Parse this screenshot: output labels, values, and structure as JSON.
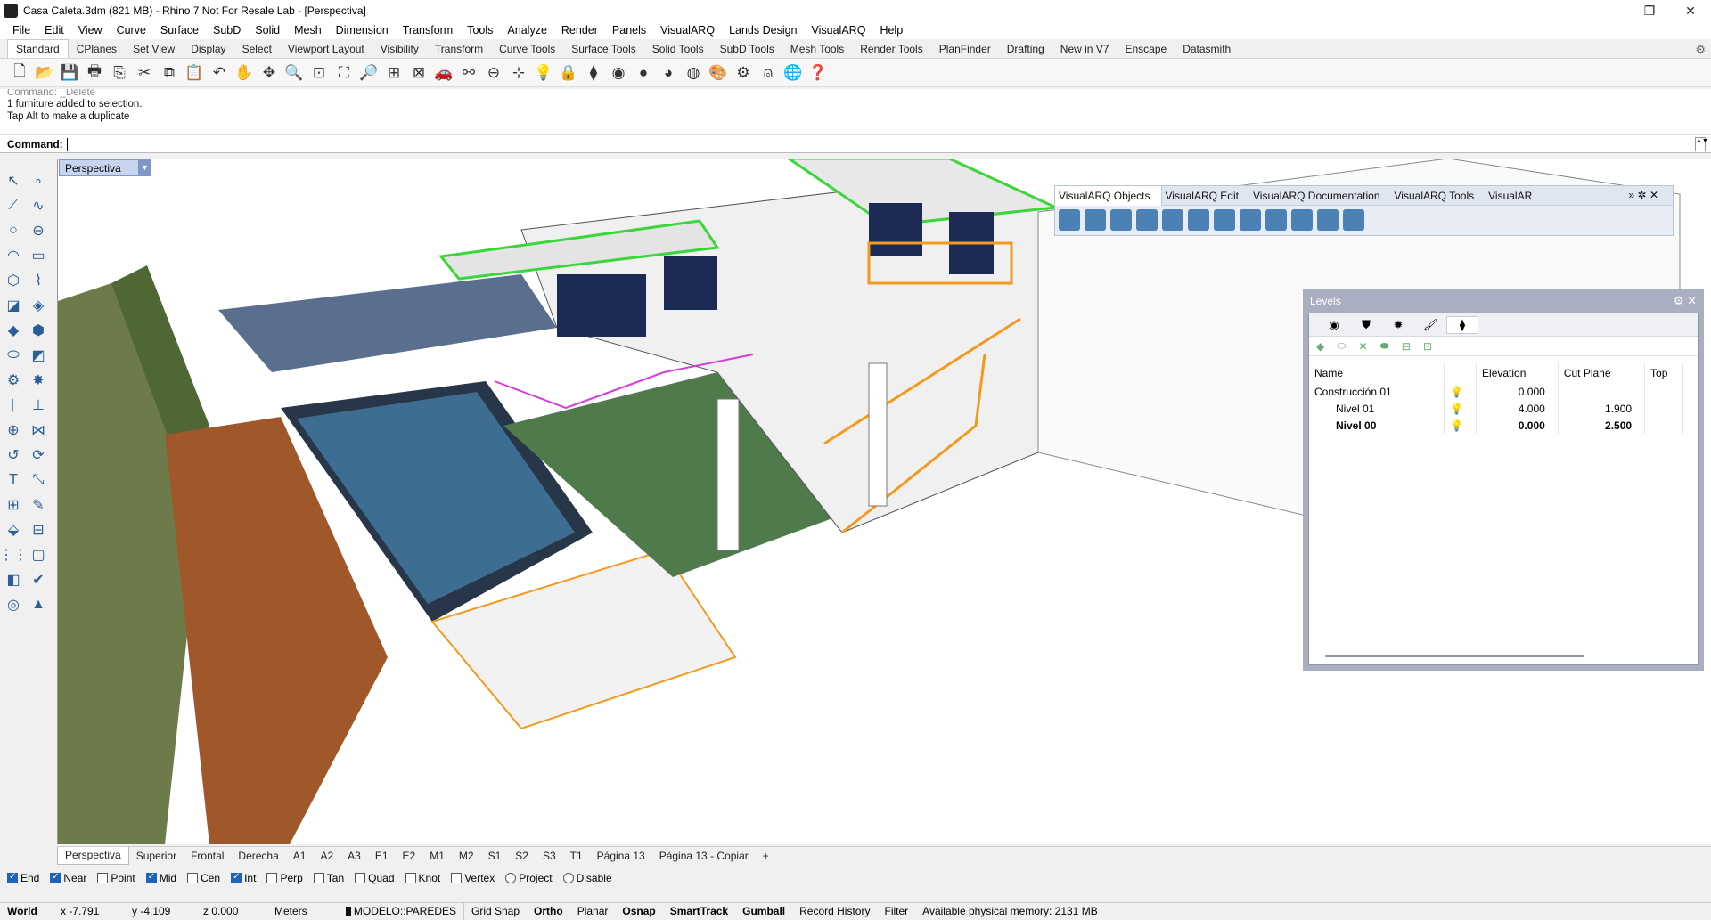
{
  "window": {
    "title": "Casa Caleta.3dm (821 MB) - Rhino 7 Not For Resale Lab - [Perspectiva]",
    "controls": [
      "—",
      "❐",
      "✕"
    ]
  },
  "menu": [
    "File",
    "Edit",
    "View",
    "Curve",
    "Surface",
    "SubD",
    "Solid",
    "Mesh",
    "Dimension",
    "Transform",
    "Tools",
    "Analyze",
    "Render",
    "Panels",
    "VisualARQ",
    "Lands Design",
    "VisualARQ",
    "Help"
  ],
  "toolbar_tabs": [
    "Standard",
    "CPlanes",
    "Set View",
    "Display",
    "Select",
    "Viewport Layout",
    "Visibility",
    "Transform",
    "Curve Tools",
    "Surface Tools",
    "Solid Tools",
    "SubD Tools",
    "Mesh Tools",
    "Render Tools",
    "PlanFinder",
    "Drafting",
    "New in V7",
    "Enscape",
    "Datasmith"
  ],
  "command_history": {
    "cut_line": "Command: _Delete",
    "lines": [
      "1 furniture added to selection.",
      "Tap Alt to make a duplicate"
    ]
  },
  "command": {
    "label": "Command:",
    "value": ""
  },
  "viewport": {
    "name": "Perspectiva"
  },
  "visualarq_toolbar": {
    "tabs": [
      "VisualARQ Objects",
      "VisualARQ Edit",
      "VisualARQ Documentation",
      "VisualARQ Tools",
      "VisualAR"
    ],
    "controls": "» ✲ ✕"
  },
  "levels": {
    "title": "Levels",
    "columns": [
      "Name",
      "",
      "Elevation",
      "Cut Plane",
      "Top"
    ],
    "rows": [
      {
        "name": "Construcción 01",
        "elevation": "0.000",
        "cut": ""
      },
      {
        "name": "Nivel 01",
        "elevation": "4.000",
        "cut": "1.900"
      },
      {
        "name": "Nivel 00",
        "elevation": "0.000",
        "cut": "2.500"
      }
    ]
  },
  "view_tabs": [
    "Perspectiva",
    "Superior",
    "Frontal",
    "Derecha",
    "A1",
    "A2",
    "A3",
    "E1",
    "E2",
    "M1",
    "M2",
    "S1",
    "S2",
    "S3",
    "T1",
    "Página 13",
    "Página 13 - Copiar",
    "+"
  ],
  "osnaps": [
    {
      "label": "End",
      "on": true
    },
    {
      "label": "Near",
      "on": true
    },
    {
      "label": "Point",
      "on": false
    },
    {
      "label": "Mid",
      "on": true
    },
    {
      "label": "Cen",
      "on": false
    },
    {
      "label": "Int",
      "on": true
    },
    {
      "label": "Perp",
      "on": false
    },
    {
      "label": "Tan",
      "on": false
    },
    {
      "label": "Quad",
      "on": false
    },
    {
      "label": "Knot",
      "on": false
    },
    {
      "label": "Vertex",
      "on": false
    },
    {
      "label": "Project",
      "on": false
    },
    {
      "label": "Disable",
      "on": false
    }
  ],
  "status": {
    "cplane": "World",
    "x": "x -7.791",
    "y": "y -4.109",
    "z": "z 0.000",
    "units": "Meters",
    "layer": "MODELO::PAREDES",
    "grid_snap": "Grid Snap",
    "ortho": "Ortho",
    "planar": "Planar",
    "osnap": "Osnap",
    "smarttrack": "SmartTrack",
    "gumball": "Gumball",
    "record_history": "Record History",
    "filter": "Filter",
    "memory": "Available physical memory: 2131 MB"
  },
  "colors": {
    "accent": "#1f63b8",
    "viewport_label": "#c7d4ef",
    "levels_panel": "#a9afc0",
    "selection_green": "#3ad63a",
    "selection_orange": "#f39a1e",
    "selection_magenta": "#d83cd8"
  }
}
